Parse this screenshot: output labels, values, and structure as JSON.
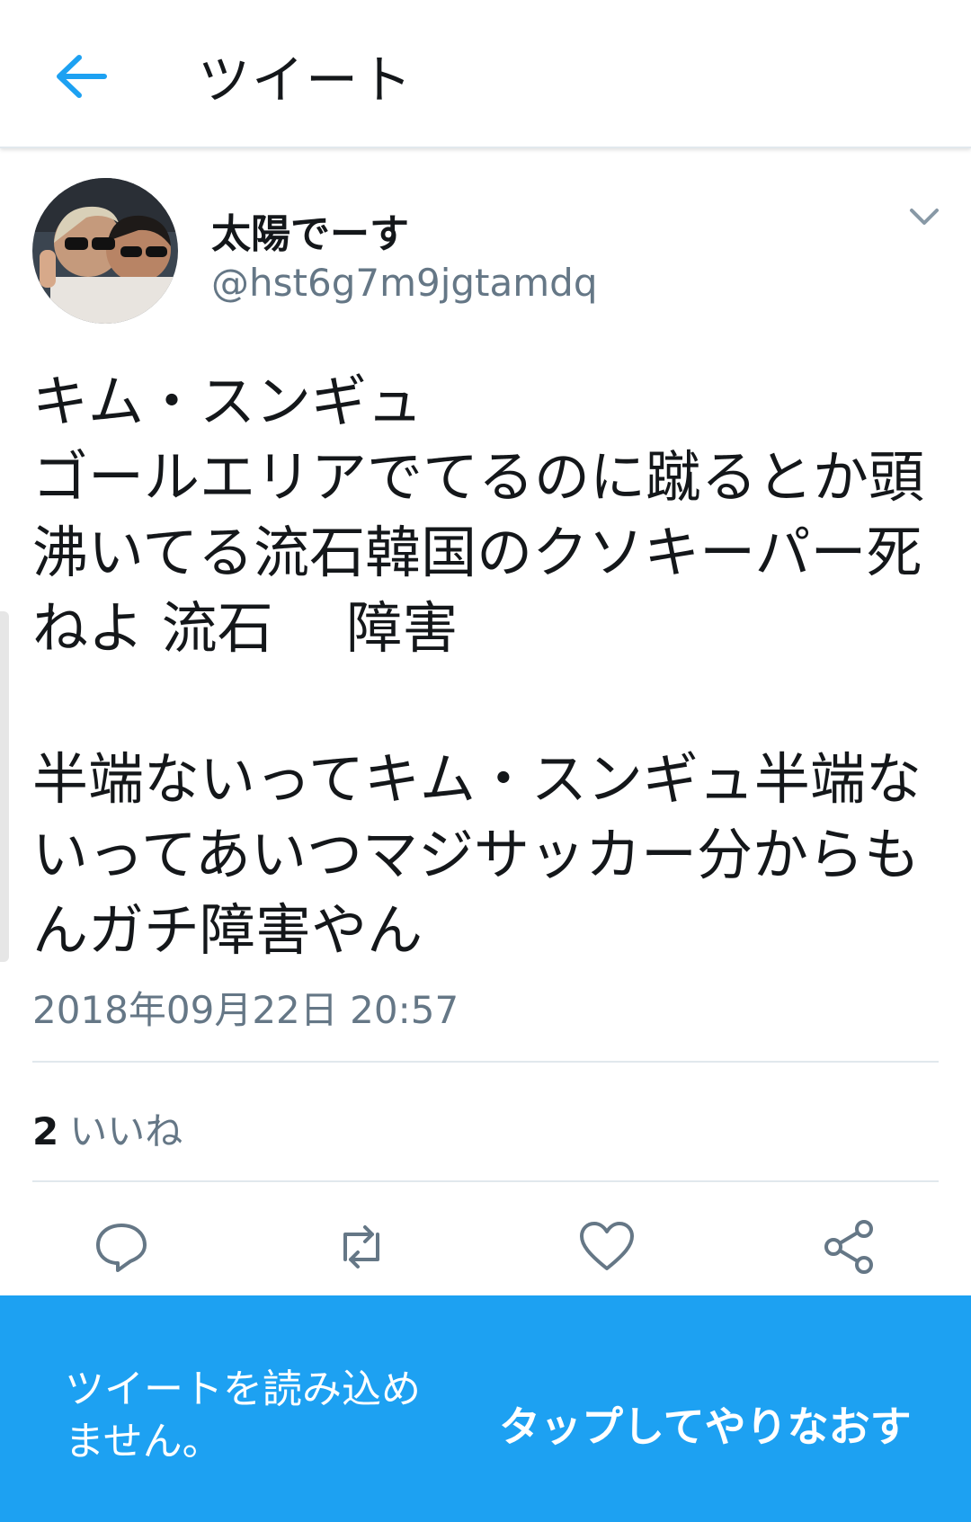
{
  "header": {
    "title": "ツイート",
    "back_icon": "arrow-left-icon"
  },
  "author": {
    "name": "太陽でーす",
    "handle": "@hst6g7m9jgtamdq"
  },
  "tweet": {
    "text": "キム・スンギュ\nゴールエリアでてるのに蹴るとか頭沸いてる流石韓国のクソキーパー死ねよ 流石　 障害\n\n半端ないってキム・スンギュ半端ないってあいつマジサッカー分からもんガチ障害やん",
    "timestamp": "2018年09月22日 20:57"
  },
  "stats": {
    "likes_count": "2",
    "likes_label": "いいね"
  },
  "actions": [
    "reply-icon",
    "retweet-icon",
    "like-icon",
    "share-icon"
  ],
  "banner": {
    "message": "ツイートを読み込めません。",
    "retry_label": "タップしてやりなおす"
  },
  "colors": {
    "accent": "#1da1f2",
    "secondary_text": "#657786",
    "divider": "#e1e8ed"
  }
}
